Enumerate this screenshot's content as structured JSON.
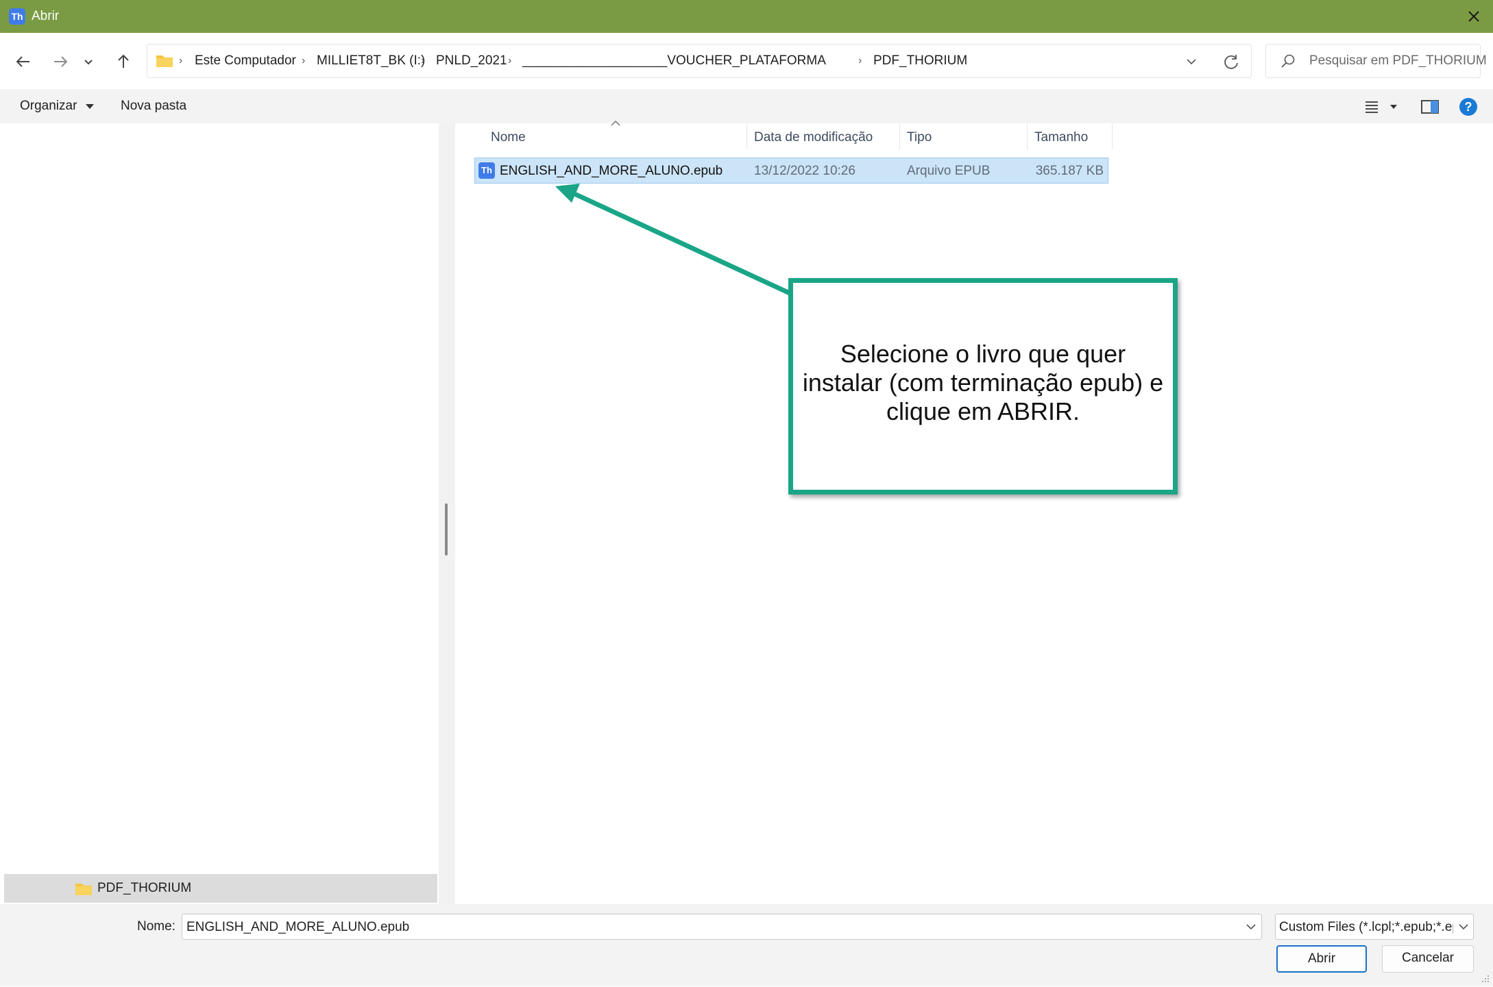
{
  "window": {
    "title": "Abrir",
    "app_icon_text": "Th"
  },
  "address": {
    "crumbs": [
      "Este Computador",
      "MILLIET8T_BK (I:)",
      "PNLD_2021",
      "____________________VOUCHER_PLATAFORMA",
      "PDF_THORIUM"
    ],
    "search_placeholder": "Pesquisar em PDF_THORIUM"
  },
  "toolbar": {
    "organize_label": "Organizar",
    "new_folder_label": "Nova pasta",
    "help_glyph": "?"
  },
  "nav_pane": {
    "selected_folder": "PDF_THORIUM"
  },
  "columns": {
    "name": "Nome",
    "modified": "Data de modificação",
    "type": "Tipo",
    "size": "Tamanho"
  },
  "files": [
    {
      "name": "ENGLISH_AND_MORE_ALUNO.epub",
      "modified": "13/12/2022 10:26",
      "type": "Arquivo EPUB",
      "size": "365.187 KB",
      "icon_text": "Th"
    }
  ],
  "annotation": {
    "text": "Selecione o livro que quer instalar (com terminação epub) e clique em ABRIR.",
    "color": "#1aa587"
  },
  "footer": {
    "name_label": "Nome:",
    "name_value": "ENGLISH_AND_MORE_ALUNO.epub",
    "filter_value": "Custom Files (*.lcpl;*.epub;*.ep",
    "open_label": "Abrir",
    "cancel_label": "Cancelar"
  },
  "colors": {
    "titlebar": "#7a9b43",
    "selection": "#cce4f7",
    "accent": "#1a7ad6"
  }
}
